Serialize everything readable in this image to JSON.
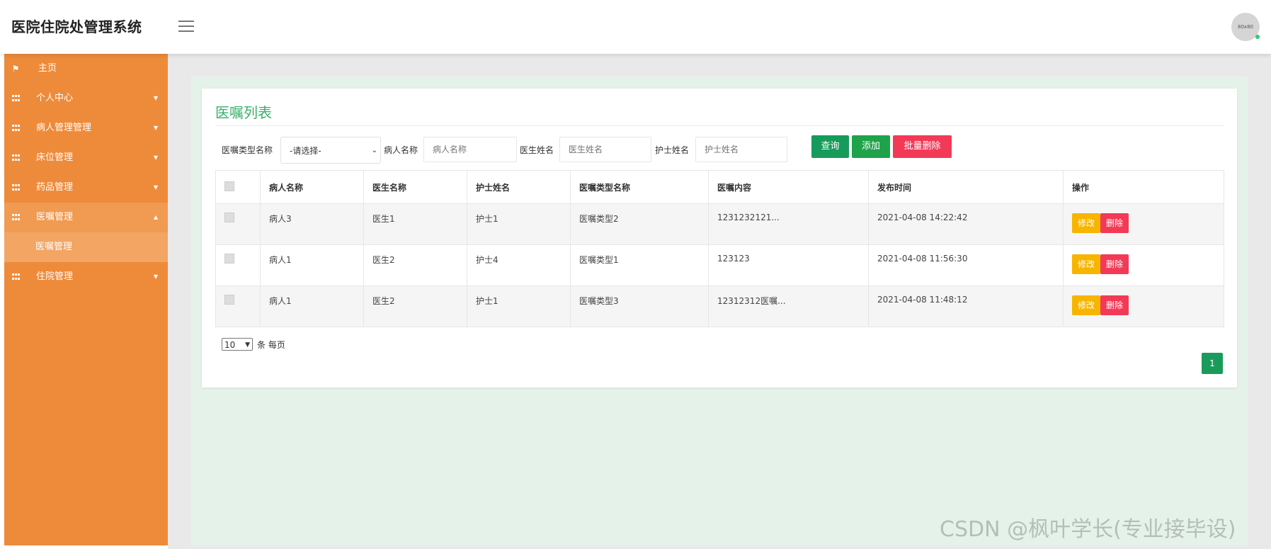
{
  "app": {
    "title": "医院住院处管理系统",
    "avatar_text": "80x80"
  },
  "sidebar": {
    "items": [
      {
        "label": "主页",
        "icon": "flag-icon"
      },
      {
        "label": "个人中心",
        "icon": "grid-icon"
      },
      {
        "label": "病人管理管理",
        "icon": "grid-icon"
      },
      {
        "label": "床位管理",
        "icon": "grid-icon"
      },
      {
        "label": "药品管理",
        "icon": "grid-icon"
      },
      {
        "label": "医嘱管理",
        "icon": "grid-icon",
        "expanded": true,
        "children": [
          {
            "label": "医嘱管理"
          }
        ]
      },
      {
        "label": "住院管理",
        "icon": "grid-icon"
      }
    ]
  },
  "page": {
    "title": "医嘱列表",
    "search": {
      "type_label": "医嘱类型名称",
      "type_selected": "-请选择-",
      "patient_label": "病人名称",
      "patient_placeholder": "病人名称",
      "doctor_label": "医生姓名",
      "doctor_placeholder": "医生姓名",
      "nurse_label": "护士姓名",
      "nurse_placeholder": "护士姓名"
    },
    "buttons": {
      "query": "查询",
      "add": "添加",
      "batch_delete": "批量删除"
    },
    "table": {
      "headers": [
        "病人名称",
        "医生名称",
        "护士姓名",
        "医嘱类型名称",
        "医嘱内容",
        "发布时间",
        "操作"
      ],
      "rows": [
        {
          "patient": "病人3",
          "doctor": "医生1",
          "nurse": "护士1",
          "type": "医嘱类型2",
          "content": "1231232121...",
          "time": "2021-04-08 14:22:42"
        },
        {
          "patient": "病人1",
          "doctor": "医生2",
          "nurse": "护士4",
          "type": "医嘱类型1",
          "content": "123123",
          "time": "2021-04-08 11:56:30"
        },
        {
          "patient": "病人1",
          "doctor": "医生2",
          "nurse": "护士1",
          "type": "医嘱类型3",
          "content": "12312312医嘱...",
          "time": "2021-04-08 11:48:12"
        }
      ],
      "action_edit": "修改",
      "action_delete": "删除"
    },
    "pagination": {
      "page_size": "10",
      "per_page_text": "条 每页",
      "current_page": "1"
    }
  },
  "watermark": "CSDN @枫叶学长(专业接毕设)",
  "colors": {
    "sidebar": "#ee8b3a",
    "accent_green": "#3ab06a",
    "query": "#169b5a",
    "add": "#1fa34a",
    "danger": "#f23a57",
    "edit": "#f7b500"
  }
}
